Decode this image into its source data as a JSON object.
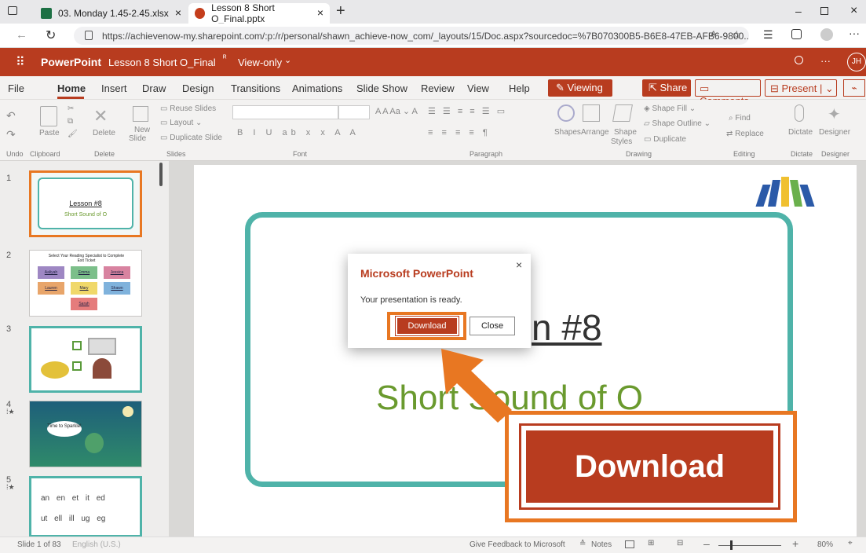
{
  "browser": {
    "tabs": [
      {
        "title": "03. Monday 1.45-2.45.xlsx"
      },
      {
        "title": "Lesson 8 Short O_Final.pptx"
      }
    ],
    "url": "https://achievenow-my.sharepoint.com/:p:/r/personal/shawn_achieve-now_com/_layouts/15/Doc.aspx?sourcedoc=%7B070300B5-B6E8-47EB-AFB6-9800..."
  },
  "app": {
    "name": "PowerPoint",
    "doc_title": "Lesson 8 Short O_Final",
    "view_mode": "View-only",
    "avatar_initials": "JH"
  },
  "ribbon": {
    "tabs": [
      "File",
      "Home",
      "Insert",
      "Draw",
      "Design",
      "Transitions",
      "Animations",
      "Slide Show",
      "Review",
      "View",
      "Help"
    ],
    "viewing": "Viewing",
    "share": "Share",
    "comments": "Comments",
    "present": "Present",
    "groups": {
      "undo": "Undo",
      "clipboard": "Clipboard",
      "delete": "Delete",
      "slides": "Slides",
      "font": "Font",
      "paragraph": "Paragraph",
      "drawing": "Drawing",
      "editing": "Editing",
      "dictate": "Dictate",
      "designer": "Designer"
    },
    "buttons": {
      "paste": "Paste",
      "delete": "Delete",
      "new": "New",
      "slide": "Slide",
      "reuse": "Reuse Slides",
      "layout": "Layout",
      "duplicate_slide": "Duplicate Slide",
      "shapes": "Shapes",
      "arrange": "Arrange",
      "shape": "Shape",
      "styles": "Styles",
      "shape_fill": "Shape Fill",
      "shape_outline": "Shape Outline",
      "duplicate": "Duplicate",
      "find": "Find",
      "replace": "Replace",
      "dictate": "Dictate",
      "designer": "Designer"
    }
  },
  "thumbnails": [
    {
      "num": "1",
      "line1": "Lesson #8",
      "line2": "Short Sound of O"
    },
    {
      "num": "2",
      "title": "Select Your Reading Specialist to Complete Exit Ticket",
      "names": [
        "Aaliyah",
        "Emma",
        "Jessica",
        "Lauren",
        "Mary",
        "Shawn",
        "Sarah"
      ]
    },
    {
      "num": "3"
    },
    {
      "num": "4",
      "bubble": "Time to Sparkle!"
    },
    {
      "num": "5",
      "row1": "an en et it ed",
      "row2": "ut ell ill ug eg"
    }
  ],
  "slide": {
    "title": "Lesson #8",
    "title_visible": "n #8",
    "subtitle": "Short Sound of O"
  },
  "dialog": {
    "title": "Microsoft PowerPoint",
    "message": "Your presentation is ready.",
    "download": "Download",
    "close": "Close"
  },
  "callout": {
    "label": "Download"
  },
  "status": {
    "slide_info": "Slide 1 of 83",
    "language": "English (U.S.)",
    "feedback": "Give Feedback to Microsoft",
    "notes": "Notes",
    "zoom": "80%"
  },
  "colors": {
    "brand": "#b83c1f",
    "accent_orange": "#e87722",
    "teal": "#4fb3a9",
    "green_text": "#6a9a2e"
  }
}
